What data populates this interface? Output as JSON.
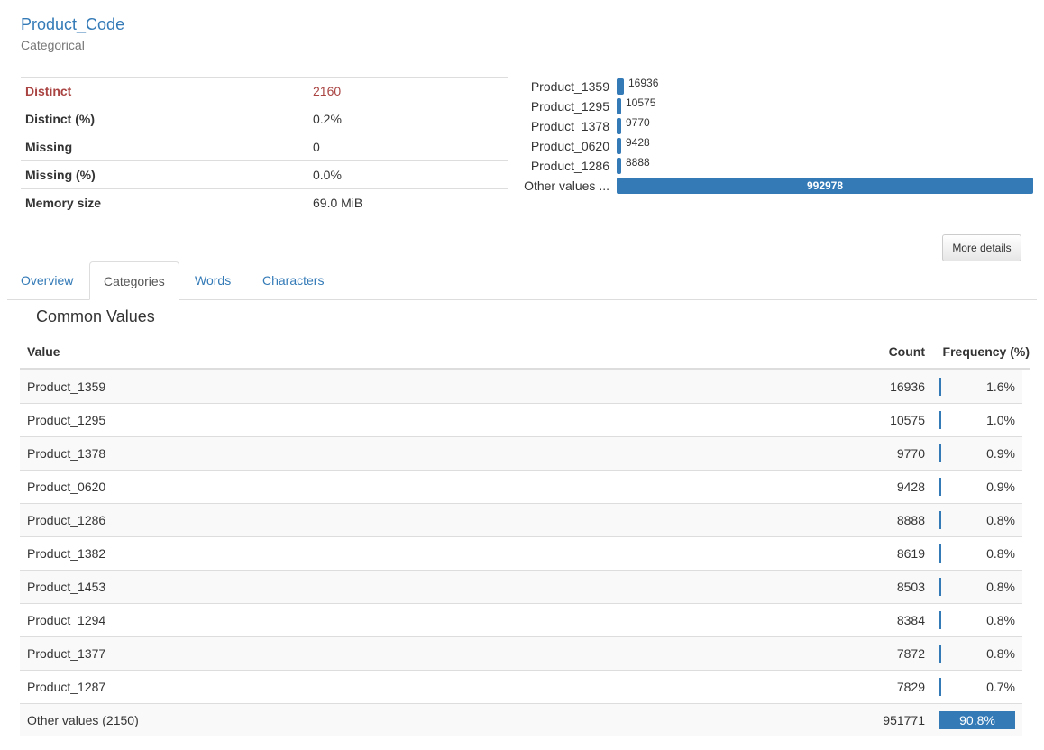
{
  "variable": {
    "name": "Product_Code",
    "type": "Categorical"
  },
  "stats": [
    {
      "label": "Distinct",
      "value": "2160",
      "alert": true
    },
    {
      "label": "Distinct (%)",
      "value": "0.2%",
      "alert": false
    },
    {
      "label": "Missing",
      "value": "0",
      "alert": false
    },
    {
      "label": "Missing (%)",
      "value": "0.0%",
      "alert": false
    },
    {
      "label": "Memory size",
      "value": "69.0 MiB",
      "alert": false
    }
  ],
  "mini_chart": {
    "type": "bar",
    "categories": [
      "Product_1359",
      "Product_1295",
      "Product_1378",
      "Product_0620",
      "Product_1286",
      "Other values ..."
    ],
    "values": [
      16936,
      10575,
      9770,
      9428,
      8888,
      992978
    ],
    "value_labels": [
      "16936",
      "10575",
      "9770",
      "9428",
      "8888",
      "992978"
    ],
    "bar_color": "#337ab7"
  },
  "more_details_label": "More details",
  "tabs": [
    {
      "label": "Overview",
      "active": false
    },
    {
      "label": "Categories",
      "active": true
    },
    {
      "label": "Words",
      "active": false
    },
    {
      "label": "Characters",
      "active": false
    }
  ],
  "common_values": {
    "title": "Common Values",
    "headers": {
      "value": "Value",
      "count": "Count",
      "frequency": "Frequency (%)"
    },
    "rows": [
      {
        "value": "Product_1359",
        "count": "16936",
        "frequency": "1.6%",
        "fraction": 0.016
      },
      {
        "value": "Product_1295",
        "count": "10575",
        "frequency": "1.0%",
        "fraction": 0.01
      },
      {
        "value": "Product_1378",
        "count": "9770",
        "frequency": "0.9%",
        "fraction": 0.009
      },
      {
        "value": "Product_0620",
        "count": "9428",
        "frequency": "0.9%",
        "fraction": 0.009
      },
      {
        "value": "Product_1286",
        "count": "8888",
        "frequency": "0.8%",
        "fraction": 0.008
      },
      {
        "value": "Product_1382",
        "count": "8619",
        "frequency": "0.8%",
        "fraction": 0.008
      },
      {
        "value": "Product_1453",
        "count": "8503",
        "frequency": "0.8%",
        "fraction": 0.008
      },
      {
        "value": "Product_1294",
        "count": "8384",
        "frequency": "0.8%",
        "fraction": 0.008
      },
      {
        "value": "Product_1377",
        "count": "7872",
        "frequency": "0.8%",
        "fraction": 0.008
      },
      {
        "value": "Product_1287",
        "count": "7829",
        "frequency": "0.7%",
        "fraction": 0.007
      },
      {
        "value": "Other values (2150)",
        "count": "951771",
        "frequency": "90.8%",
        "fraction": 0.908
      }
    ]
  }
}
